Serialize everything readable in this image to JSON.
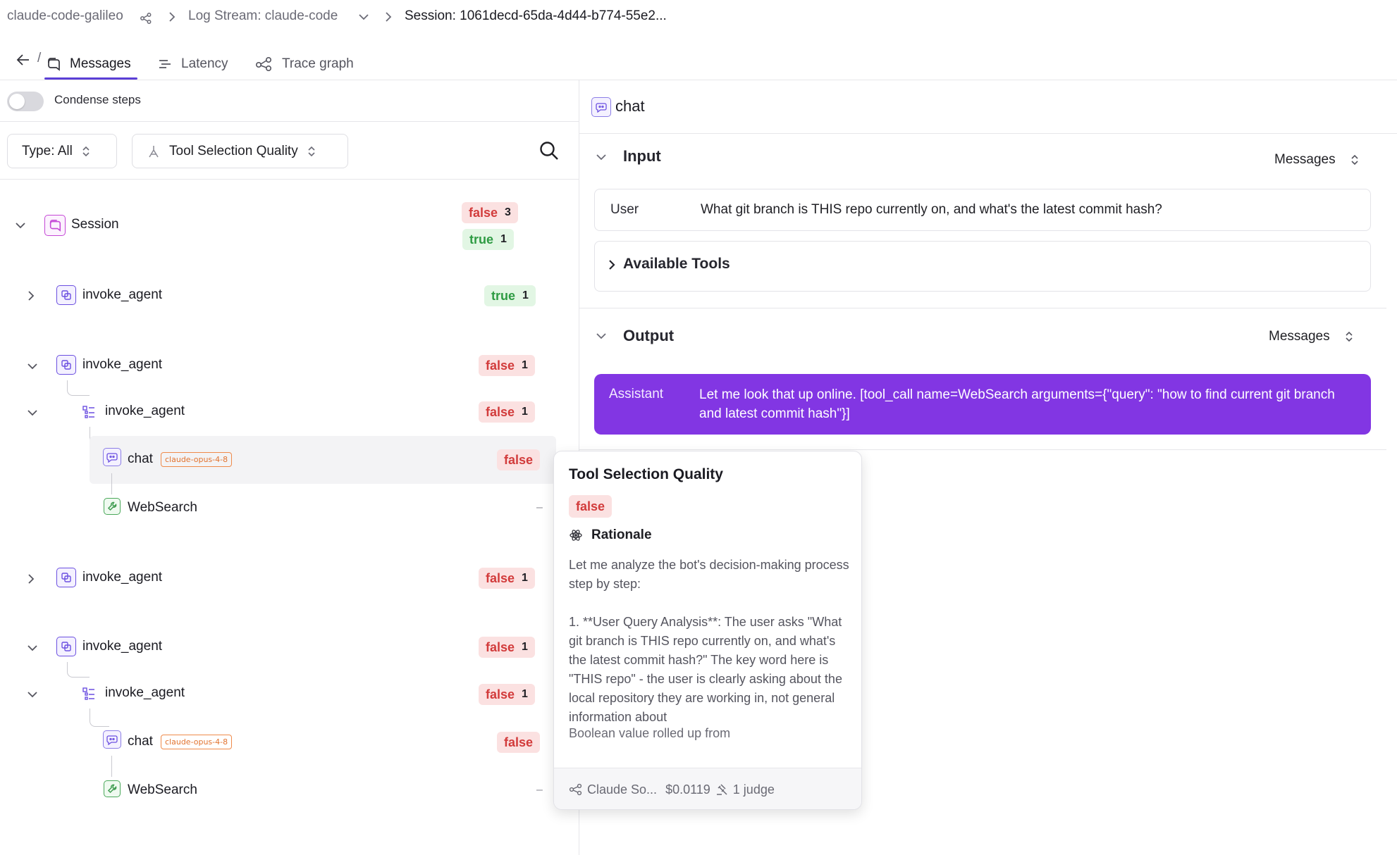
{
  "breadcrumb": {
    "project": "claude-code-galileo",
    "log_stream": "Log Stream: claude-code",
    "session": "Session: 1061decd-65da-4d44-b774-55e2..."
  },
  "tabs": {
    "back_sep": "/",
    "messages": "Messages",
    "latency": "Latency",
    "trace_graph": "Trace graph"
  },
  "left": {
    "condense_label": "Condense steps",
    "condense_on": false,
    "type_filter": "Type: All",
    "metric_filter": "Tool Selection Quality"
  },
  "tree": {
    "session": {
      "label": "Session",
      "false_label": "false",
      "false_count": "3",
      "true_label": "true",
      "true_count": "1"
    },
    "n1": {
      "label": "invoke_agent",
      "badge": "true",
      "count": "1"
    },
    "n2": {
      "label": "invoke_agent",
      "badge": "false",
      "count": "1"
    },
    "n2a": {
      "label": "invoke_agent",
      "badge": "false",
      "count": "1"
    },
    "n2chat": {
      "label": "chat",
      "model": "claude-opus-4-8",
      "badge": "false"
    },
    "n2tool": {
      "label": "WebSearch",
      "value": "–"
    },
    "n3": {
      "label": "invoke_agent",
      "badge": "false",
      "count": "1"
    },
    "n4": {
      "label": "invoke_agent",
      "badge": "false",
      "count": "1"
    },
    "n4a": {
      "label": "invoke_agent",
      "badge": "false",
      "count": "1"
    },
    "n4chat": {
      "label": "chat",
      "model": "claude-opus-4-8",
      "badge": "false"
    },
    "n4tool": {
      "label": "WebSearch",
      "value": "–"
    }
  },
  "right": {
    "title": "chat",
    "input": {
      "title": "Input",
      "format": "Messages",
      "role": "User",
      "text": "What git branch is THIS repo currently on, and what's the latest commit hash?",
      "tools_label": "Available Tools"
    },
    "output": {
      "title": "Output",
      "format": "Messages",
      "role": "Assistant",
      "text": "Let me look that up online. [tool_call name=WebSearch arguments={\"query\": \"how to find current git branch and latest commit hash\"}]"
    }
  },
  "tooltip": {
    "title": "Tool Selection Quality",
    "value": "false",
    "rationale_label": "Rationale",
    "rationale": "Let me analyze the bot's decision-making process step by step:\n\n1. **User Query Analysis**: The user asks \"What git branch is THIS repo currently on, and what's the latest commit hash?\" The key word here is \"THIS repo\" - the user is clearly asking about the local repository they are working in, not general information about",
    "rollup": "Boolean value rolled up from",
    "model": "Claude So...",
    "cost": "$0.0119",
    "judges": "1 judge"
  },
  "colors": {
    "accent": "#5b3fd6",
    "assistant_bg": "#8236e3",
    "false_bg": "#fbe1e1",
    "false_fg": "#d23b3b",
    "true_bg": "#e2f6e4",
    "true_fg": "#2e9b43",
    "model_tag": "#ef8a4a"
  }
}
